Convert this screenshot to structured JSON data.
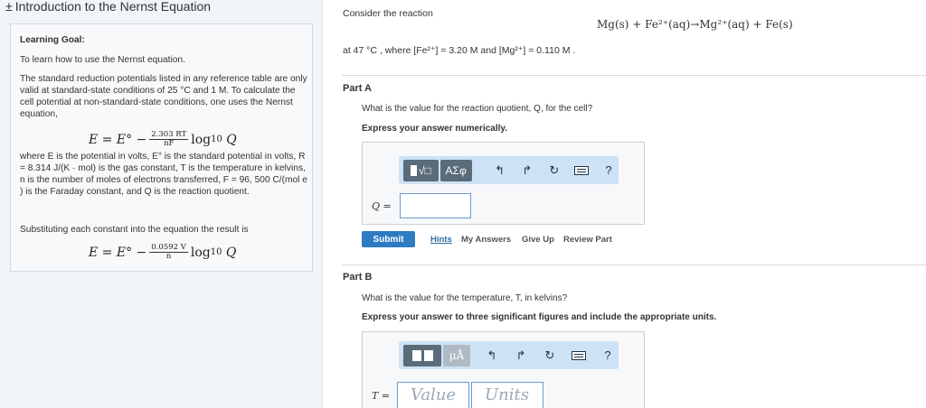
{
  "header": {
    "expand_symbol": "±",
    "title": "Introduction to the Nernst Equation"
  },
  "goal": {
    "heading": "Learning Goal:",
    "intro": "To learn how to use the Nernst equation.",
    "para1": "The standard reduction potentials listed in any reference table are only valid at standard-state conditions of 25 °C and 1 M. To calculate the cell potential at non-standard-state conditions, one uses the Nernst equation,",
    "eq1": {
      "lhs": "E = E° −",
      "num": "2.303 RT",
      "den": "nF",
      "log": "log",
      "base": "10",
      "arg": "Q"
    },
    "para2": "where E is the potential in volts, E° is the standard potential in volts, R = 8.314 J/(K · mol) is the gas constant, T is the temperature in kelvins, n is the number of moles of electrons transferred, F = 96, 500 C/(mol e ) is the Faraday constant, and Q is the reaction quotient.",
    "para3": "Substituting each constant into the equation the result is",
    "eq2": {
      "lhs": "E = E° −",
      "num": "0.0592 V",
      "den": "n",
      "log": "log",
      "base": "10",
      "arg": "Q"
    }
  },
  "problem": {
    "consider": "Consider the reaction",
    "reaction": "Mg(s) + Fe²⁺(aq)→Mg²⁺(aq) + Fe(s)",
    "conditions": "at 47 °C , where [Fe²⁺] = 3.20 M and [Mg²⁺] = 0.110 M ."
  },
  "partA": {
    "title": "Part A",
    "question": "What is the value for the reaction quotient, Q, for the cell?",
    "instruction": "Express your answer numerically.",
    "toolbar": {
      "templates": "√□",
      "symbols": "ΑΣφ",
      "help": "?"
    },
    "input_label": "Q =",
    "input_value": "",
    "submit": "Submit",
    "links": {
      "hints": "Hints",
      "my_answers": "My Answers",
      "give_up": "Give Up",
      "review_part": "Review Part"
    }
  },
  "partB": {
    "title": "Part B",
    "question": "What is the value for the temperature, T, in kelvins?",
    "instruction": "Express your answer to three significant figures and include the appropriate units.",
    "toolbar": {
      "units": "μÅ",
      "help": "?"
    },
    "input_label": "T =",
    "value_placeholder": "Value",
    "units_placeholder": "Units"
  }
}
